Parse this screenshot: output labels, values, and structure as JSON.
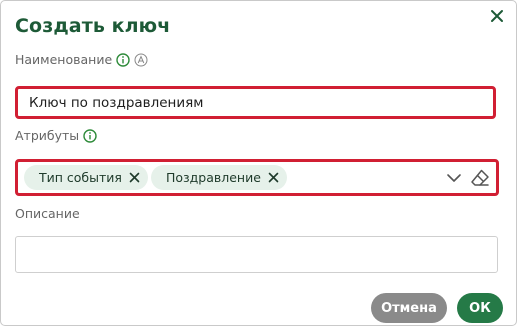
{
  "dialog": {
    "title": "Создать ключ",
    "close_icon": "close-icon"
  },
  "name_field": {
    "label": "Наименование",
    "info_icon": "info-icon",
    "auto_icon": "a-circle-icon",
    "value": "Ключ по поздравлениям",
    "state": "error-highlight"
  },
  "attributes_field": {
    "label": "Атрибуты",
    "info_icon": "info-icon",
    "chips": [
      {
        "label": "Тип события"
      },
      {
        "label": "Поздравление"
      }
    ],
    "chevron_icon": "chevron-down-icon",
    "clear_icon": "eraser-icon",
    "state": "error-highlight"
  },
  "description_field": {
    "label": "Описание",
    "value": ""
  },
  "buttons": {
    "cancel_label": "Отмена",
    "ok_label": "ОК"
  },
  "colors": {
    "title": "#1d5a37",
    "accent_green": "#257a47",
    "error_red": "#d11f33",
    "chip_bg": "#e6f1ea",
    "cancel_gray": "#8a8a8a"
  }
}
